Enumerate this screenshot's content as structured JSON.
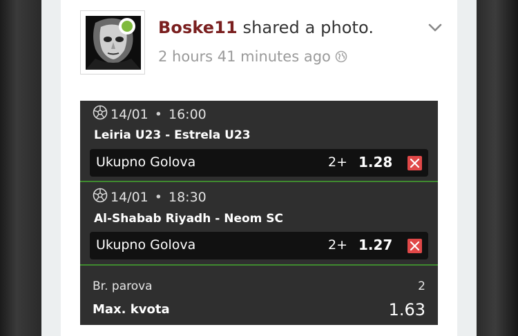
{
  "post": {
    "username": "Boske11",
    "action": " shared a photo.",
    "time": "2 hours 41 minutes ago",
    "online_color": "#7fba3d",
    "username_color": "#7a1f1f"
  },
  "ticket": {
    "matches": [
      {
        "date": "14/01",
        "time": "16:00",
        "teams": "Leiria U23 - Estrela U23",
        "market": "Ukupno Golova",
        "pick": "2+",
        "odd": "1.28"
      },
      {
        "date": "14/01",
        "time": "18:30",
        "teams": "Al-Shabab Riyadh - Neom SC",
        "market": "Ukupno Golova",
        "pick": "2+",
        "odd": "1.27"
      }
    ],
    "pairs_label": "Br. parova",
    "pairs_value": "2",
    "max_label": "Max. kvota",
    "max_value": "1.63",
    "accent_color": "#3f8a2f",
    "remove_color": "#e04848"
  }
}
